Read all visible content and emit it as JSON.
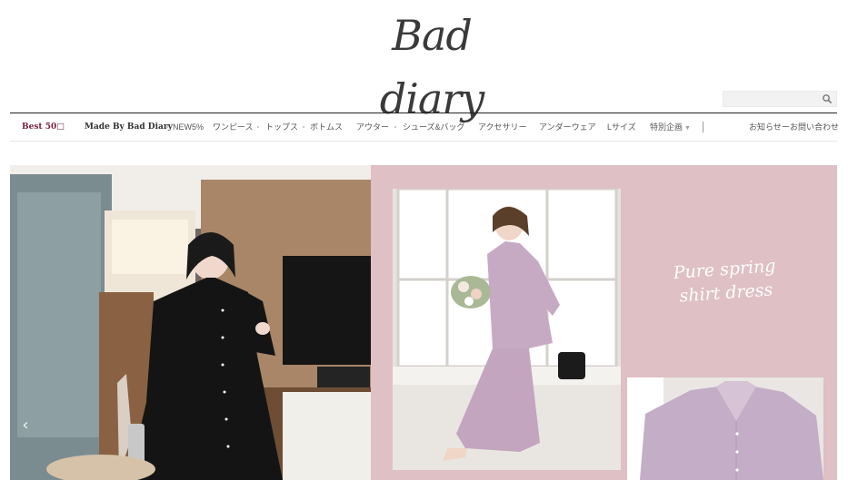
{
  "logo": {
    "text": "Bad diary"
  },
  "search": {
    "placeholder": ""
  },
  "nav": {
    "items": [
      "Best 50□",
      "Made By Bad Diary",
      "NEW5%",
      "ワンピース",
      "トップス",
      "ボトムス",
      "アウター",
      "シューズ&バッグ",
      "アクセサリー",
      "アンダーウェア",
      "Lサイズ",
      "特別企画"
    ],
    "right_items": [
      "お知らせー",
      "お問い合わせ"
    ]
  },
  "banner": {
    "script_line1": "Pure spring",
    "script_line2": "shirt dress",
    "prev_arrow": "‹"
  },
  "colors": {
    "accent": "#7a1f3d",
    "panel": "#dfc0c4",
    "dress_black": "#141414",
    "dress_lilac": "#c6aac3"
  }
}
